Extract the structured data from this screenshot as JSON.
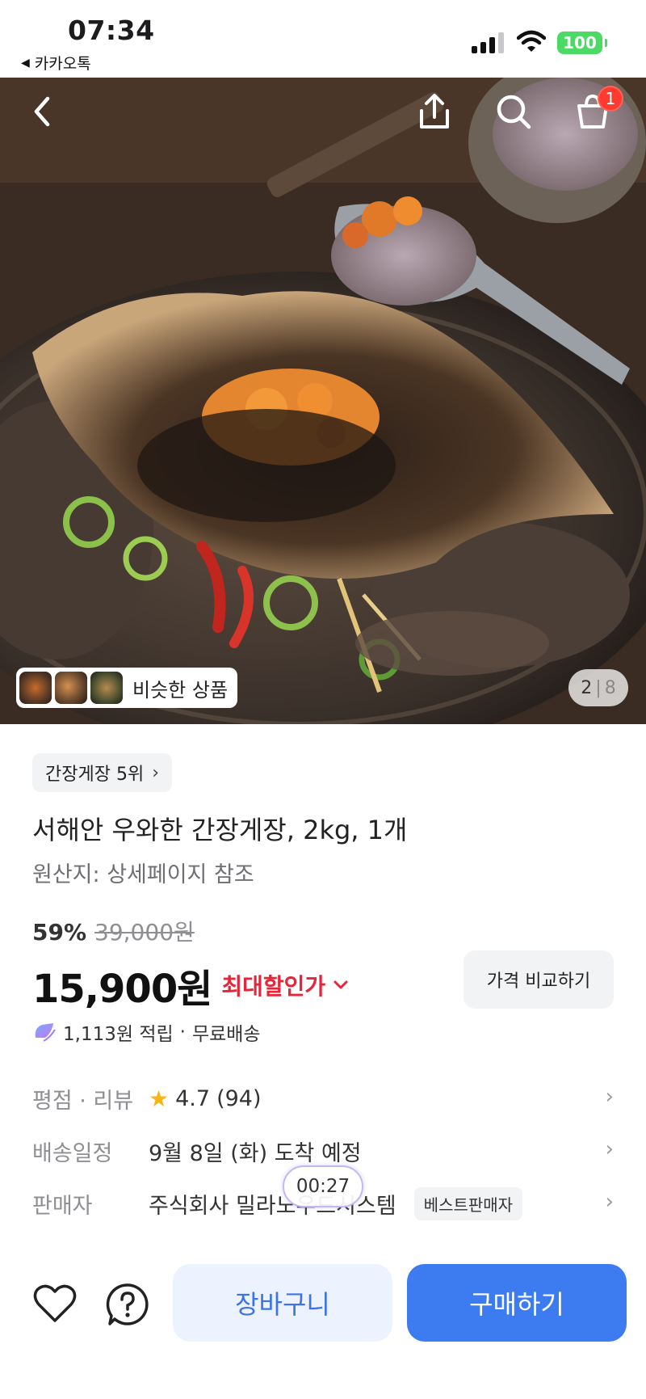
{
  "status_bar": {
    "time": "07:34",
    "back_app": "카카오톡",
    "battery": "100",
    "icons": [
      "signal-icon",
      "wifi-icon",
      "battery-icon"
    ]
  },
  "header": {
    "icons": [
      "back-icon",
      "share-icon",
      "search-icon",
      "cart-icon"
    ],
    "cart_badge": "1"
  },
  "gallery": {
    "similar_label": "비슷한 상품",
    "current_page": "2",
    "separator": "|",
    "total_pages": "8"
  },
  "product": {
    "rank": "간장게장 5위",
    "title": "서해안 우와한 간장게장, 2kg, 1개",
    "origin": "원산지: 상세페이지 참조",
    "discount": "59%",
    "original_price": "39,000원",
    "price": "15,900원",
    "best_price_label": "최대할인가",
    "compare_label": "가격 비교하기",
    "points": "1,113원 적립",
    "points_separator": "·",
    "shipping": "무료배송"
  },
  "attributes": {
    "rating_label": "평점 · 리뷰",
    "rating": "4.7",
    "review_count": "(94)",
    "delivery_label": "배송일정",
    "delivery_value": "9월 8일 (화) 도착 예정",
    "seller_label": "판매자",
    "seller_value": "주식회사 밀라노우드시스템",
    "seller_badge": "베스트판매자"
  },
  "overlay": {
    "timer": "00:27"
  },
  "bottom_bar": {
    "cart_label": "장바구니",
    "buy_label": "구매하기",
    "icons": [
      "heart-icon",
      "question-icon"
    ]
  },
  "colors": {
    "accent_blue": "#3c7bf0",
    "cart_button_bg": "#ecf2fe",
    "discount_red": "#e5263a",
    "battery_green": "#4cd964",
    "badge_red": "#ff3b30",
    "star_yellow": "#f6b619"
  }
}
